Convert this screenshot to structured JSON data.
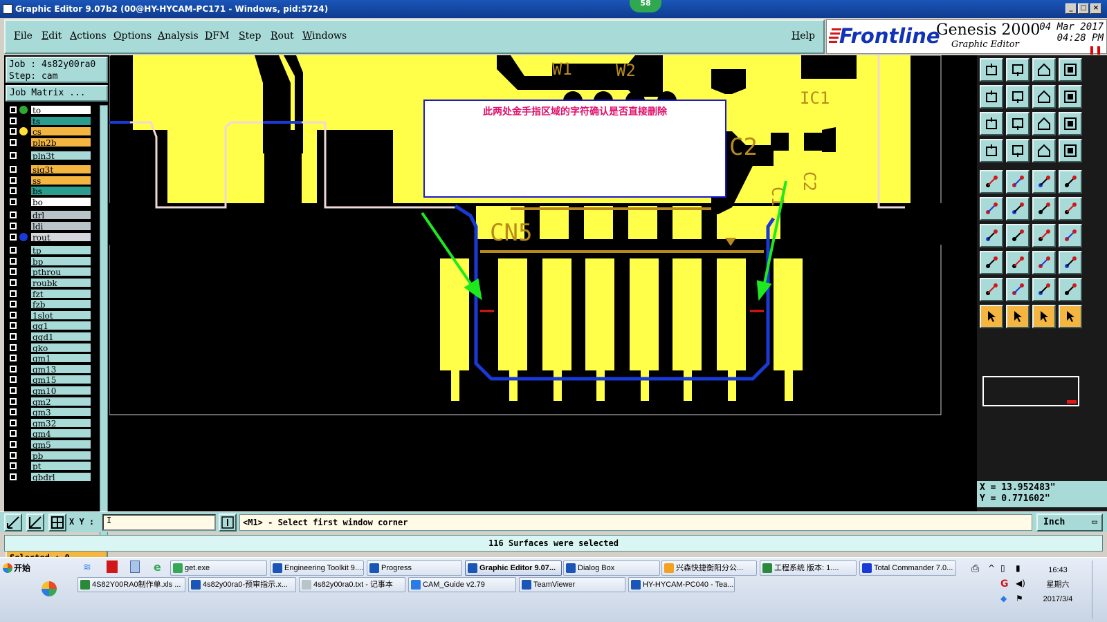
{
  "window": {
    "title": "Graphic Editor 9.07b2 (00@HY-HYCAM-PC171 - Windows, pid:5724)",
    "badge": "58"
  },
  "menu": {
    "items": [
      "File",
      "Edit",
      "Actions",
      "Options",
      "Analysis",
      "DFM",
      "Step",
      "Rout",
      "Windows"
    ],
    "help": "Help"
  },
  "brand": {
    "logo": "Frontline",
    "product": "Genesis 2000",
    "subtitle": "Graphic Editor",
    "date": "04 Mar 2017",
    "time": "04:28 PM"
  },
  "job": {
    "job_line": "Job : 4s82y00ra0",
    "step_line": "Step: cam",
    "matrix_button": "Job Matrix ..."
  },
  "layers": [
    {
      "name": "to",
      "bg": "#ffffff",
      "dot": "#2fa82f"
    },
    {
      "name": "ts",
      "bg": "#2a9d8f",
      "dot": ""
    },
    {
      "name": "cs",
      "bg": "#f4b640",
      "dot": "#ffe135"
    },
    {
      "name": "pln2b",
      "bg": "#f4b640",
      "dot": ""
    },
    {
      "name": "pln3t",
      "bg": "#a8dad8",
      "dot": ""
    },
    {
      "name": "sig3t",
      "bg": "#f4b640",
      "dot": ""
    },
    {
      "name": "ss",
      "bg": "#f4b640",
      "dot": ""
    },
    {
      "name": "bs",
      "bg": "#2a9d8f",
      "dot": ""
    },
    {
      "name": "bo",
      "bg": "#ffffff",
      "dot": ""
    },
    {
      "name": "drl",
      "bg": "#b8c4c8",
      "dot": ""
    },
    {
      "name": "ldi",
      "bg": "#b8c4c8",
      "dot": ""
    },
    {
      "name": "rout",
      "bg": "#d4d8dc",
      "dot": "#1a3ad8"
    },
    {
      "name": "tp",
      "bg": "#a8dad8",
      "dot": ""
    },
    {
      "name": "bp",
      "bg": "#a8dad8",
      "dot": ""
    },
    {
      "name": "pthrou",
      "bg": "#a8dad8",
      "dot": ""
    },
    {
      "name": "roubk",
      "bg": "#a8dad8",
      "dot": ""
    },
    {
      "name": "fzt",
      "bg": "#a8dad8",
      "dot": ""
    },
    {
      "name": "fzb",
      "bg": "#a8dad8",
      "dot": ""
    },
    {
      "name": "1slot",
      "bg": "#a8dad8",
      "dot": ""
    },
    {
      "name": "gg1",
      "bg": "#a8dad8",
      "dot": ""
    },
    {
      "name": "ggd1",
      "bg": "#a8dad8",
      "dot": ""
    },
    {
      "name": "gko",
      "bg": "#a8dad8",
      "dot": ""
    },
    {
      "name": "gm1",
      "bg": "#a8dad8",
      "dot": ""
    },
    {
      "name": "gm13",
      "bg": "#a8dad8",
      "dot": ""
    },
    {
      "name": "gm15",
      "bg": "#a8dad8",
      "dot": ""
    },
    {
      "name": "gm10",
      "bg": "#a8dad8",
      "dot": ""
    },
    {
      "name": "gm2",
      "bg": "#a8dad8",
      "dot": ""
    },
    {
      "name": "gm3",
      "bg": "#a8dad8",
      "dot": ""
    },
    {
      "name": "gm32",
      "bg": "#a8dad8",
      "dot": ""
    },
    {
      "name": "gm4",
      "bg": "#a8dad8",
      "dot": ""
    },
    {
      "name": "gm5",
      "bg": "#a8dad8",
      "dot": ""
    },
    {
      "name": "pb",
      "bg": "#a8dad8",
      "dot": ""
    },
    {
      "name": "pt",
      "bg": "#a8dad8",
      "dot": ""
    },
    {
      "name": "gbdrl",
      "bg": "#a8dad8",
      "dot": ""
    }
  ],
  "selected_label": "Selected : 0",
  "canvas": {
    "annotation": "此两处金手指区域的字符确认是否直接删除",
    "silk_labels": [
      "W1",
      "W2",
      "IC1",
      "C2",
      "CN5",
      "C1",
      "C2"
    ]
  },
  "coords": {
    "x": "X = 13.952483\"",
    "y": "Y = 0.771602\""
  },
  "command": {
    "xy_label": "X Y :",
    "xy_value": "I",
    "prompt": "<M1> - Select first window corner",
    "units": "Inch"
  },
  "status": "116 Surfaces were selected",
  "taskbar": {
    "start": "开始",
    "row1": [
      "get.exe",
      "Engineering Toolkit 9....",
      "Progress",
      "Graphic Editor 9.07...",
      "Dialog Box",
      "兴森快捷衡阳分公...",
      "工程系统  版本: 1....",
      "Total Commander 7.0..."
    ],
    "row2": [
      "4S82Y00RA0制作单.xls ...",
      "4s82y00ra0-预审指示.x...",
      "4s82y00ra0.txt - 记事本",
      "CAM_Guide v2.79",
      "TeamViewer",
      "HY-HYCAM-PC040 - Tea..."
    ],
    "time": "16:43",
    "weekday": "星期六",
    "date": "2017/3/4"
  },
  "colors": {
    "copper": "#ffff4a",
    "silk": "#b88a1e",
    "rout": "#1a3ad8",
    "arrow": "#1ee81e",
    "panel": "#a8dad8"
  }
}
